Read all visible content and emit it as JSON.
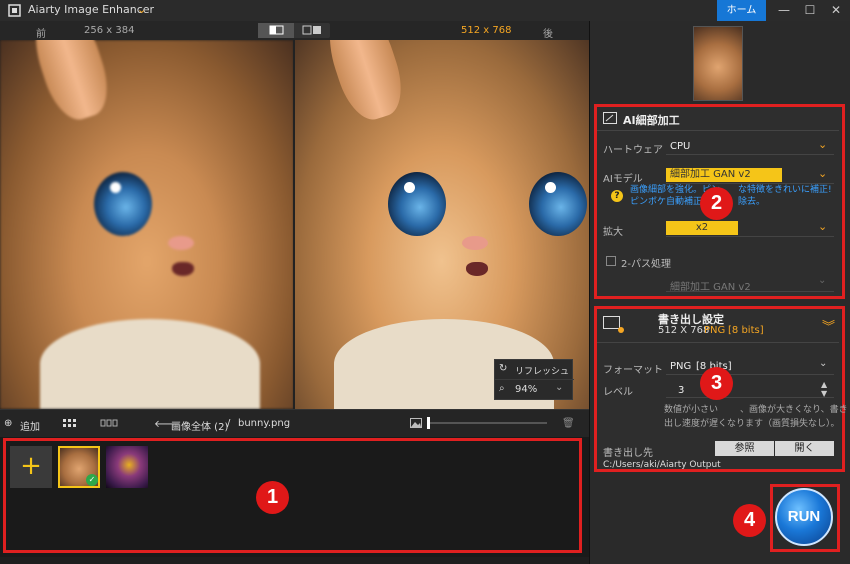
{
  "titlebar": {
    "title": "Aiarty Image Enhancer",
    "home_label": "ホーム",
    "minimize": "—",
    "maximize": "☐",
    "close": "✕"
  },
  "viewhdr": {
    "before_label": "前",
    "before_size": "256 x 384",
    "after_size": "512 x 768",
    "after_label": "後"
  },
  "preview": {
    "refresh_label": "リフレッシュ",
    "zoom": "94%"
  },
  "toolbar": {
    "add_label": "追加",
    "breadcrumb_all": "画像全体 (2)",
    "breadcrumb_sep": "/",
    "filename": "bunny.png"
  },
  "thumbs": {
    "add": "+"
  },
  "badges": [
    "1",
    "2",
    "3",
    "4"
  ],
  "ai_section": {
    "title": "AI細部加工",
    "hardware_label": "ハートウェア",
    "hardware_value": "CPU",
    "model_label": "AIモデル",
    "model_value": "細部加工 GAN v2",
    "hint_line1": "画像細部を強化。ピン",
    "hint_line1b": "な特徴をきれいに補正!",
    "hint_line2": "ピンボケ自動補正・",
    "hint_line2b": "除去。",
    "scale_label": "拡大",
    "scale_value": "x2",
    "twopass_label": "2-パス処理",
    "twopass_model": "細部加工 GAN v2"
  },
  "export_section": {
    "title": "書き出し設定",
    "size": "512 X 768",
    "format_short": "PNG",
    "bits": "[8 bits]",
    "format_label": "フォーマット",
    "format_value": "PNG",
    "format_bits": "[8 bits]",
    "level_label": "レベル",
    "level_value": "3",
    "note_line1": "数値が小さい",
    "note_line1b": "、画像が大きくなり、書き",
    "note_line2": "出し速度が遅くなります（画質損失なし）。",
    "dest_label": "書き出し先",
    "browse_label": "参照",
    "open_label": "開く",
    "path": "C:/Users/aki/Aiarty Output"
  },
  "run_label": "RUN",
  "colors": {
    "accent": "#f5c518",
    "highlight": "#e02020",
    "link": "#3aa0ff",
    "home": "#1677d6"
  }
}
